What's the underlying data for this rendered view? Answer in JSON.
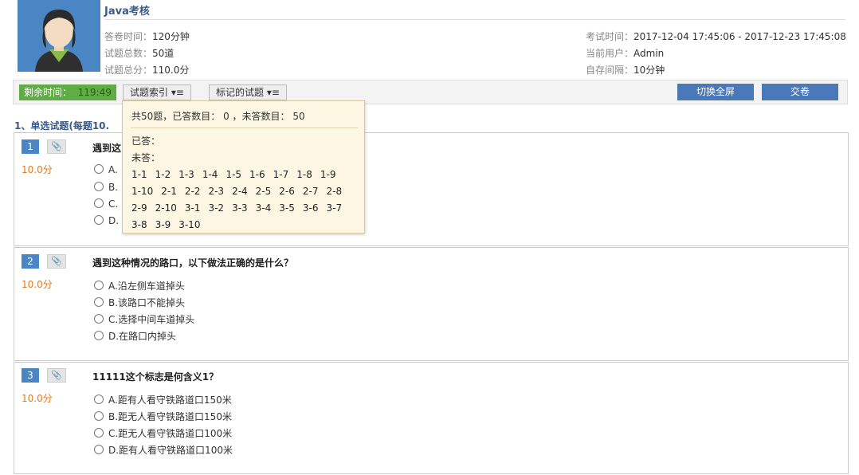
{
  "exam": {
    "title": "Java考核",
    "duration_label": "答卷时间：",
    "duration_value": "120分钟",
    "count_label": "试题总数：",
    "count_value": "50道",
    "score_label": "试题总分：",
    "score_value": "110.0分",
    "time_label": "考试时间：",
    "time_value": "2017-12-04 17:45:06 - 2017-12-23 17:45:08",
    "user_label": "当前用户：",
    "user_value": "Admin",
    "autosave_label": "自存间隔：",
    "autosave_value": "10分钟"
  },
  "toolbar": {
    "timer_label": "剩余时间：",
    "timer_value": "119:49",
    "index_button": "试题索引 ▾≡",
    "marked_button": "标记的试题 ▾≡",
    "fullscreen_button": "切换全屏",
    "submit_button": "交卷"
  },
  "section": {
    "title": "1、单选试题(每题10."
  },
  "popup": {
    "summary": "共50题，已答数目： 0 ，未答数目： 50",
    "answered_label": "已答：",
    "unanswered_label": "未答：",
    "unanswered_items": [
      "1-1",
      "1-2",
      "1-3",
      "1-4",
      "1-5",
      "1-6",
      "1-7",
      "1-8",
      "1-9",
      "1-10",
      "2-1",
      "2-2",
      "2-3",
      "2-4",
      "2-5",
      "2-6",
      "2-7",
      "2-8",
      "2-9",
      "2-10",
      "3-1",
      "3-2",
      "3-3",
      "3-4",
      "3-5",
      "3-6",
      "3-7",
      "3-8",
      "3-9",
      "3-10"
    ]
  },
  "questions": [
    {
      "number": "1",
      "score": "10.0分",
      "text": "遇到这",
      "options": [
        "A.",
        "B.",
        "C.",
        "D."
      ]
    },
    {
      "number": "2",
      "score": "10.0分",
      "text": "遇到这种情况的路口，以下做法正确的是什么？",
      "options": [
        "A.沿左侧车道掉头",
        "B.该路口不能掉头",
        "C.选择中间车道掉头",
        "D.在路口内掉头"
      ]
    },
    {
      "number": "3",
      "score": "10.0分",
      "text": "11111这个标志是何含义1？",
      "options": [
        "A.距有人看守铁路道口150米",
        "B.距无人看守铁路道口150米",
        "C.距无人看守铁路道口100米",
        "D.距有人看守铁路道口100米"
      ]
    }
  ],
  "icons": {
    "avatar": "user-avatar",
    "attach": "paperclip-icon",
    "radio": "radio-icon"
  },
  "colors": {
    "accent": "#4a86c4",
    "timer_bg": "#5fad44",
    "score": "#e07b1f",
    "button": "#4a78b8"
  }
}
